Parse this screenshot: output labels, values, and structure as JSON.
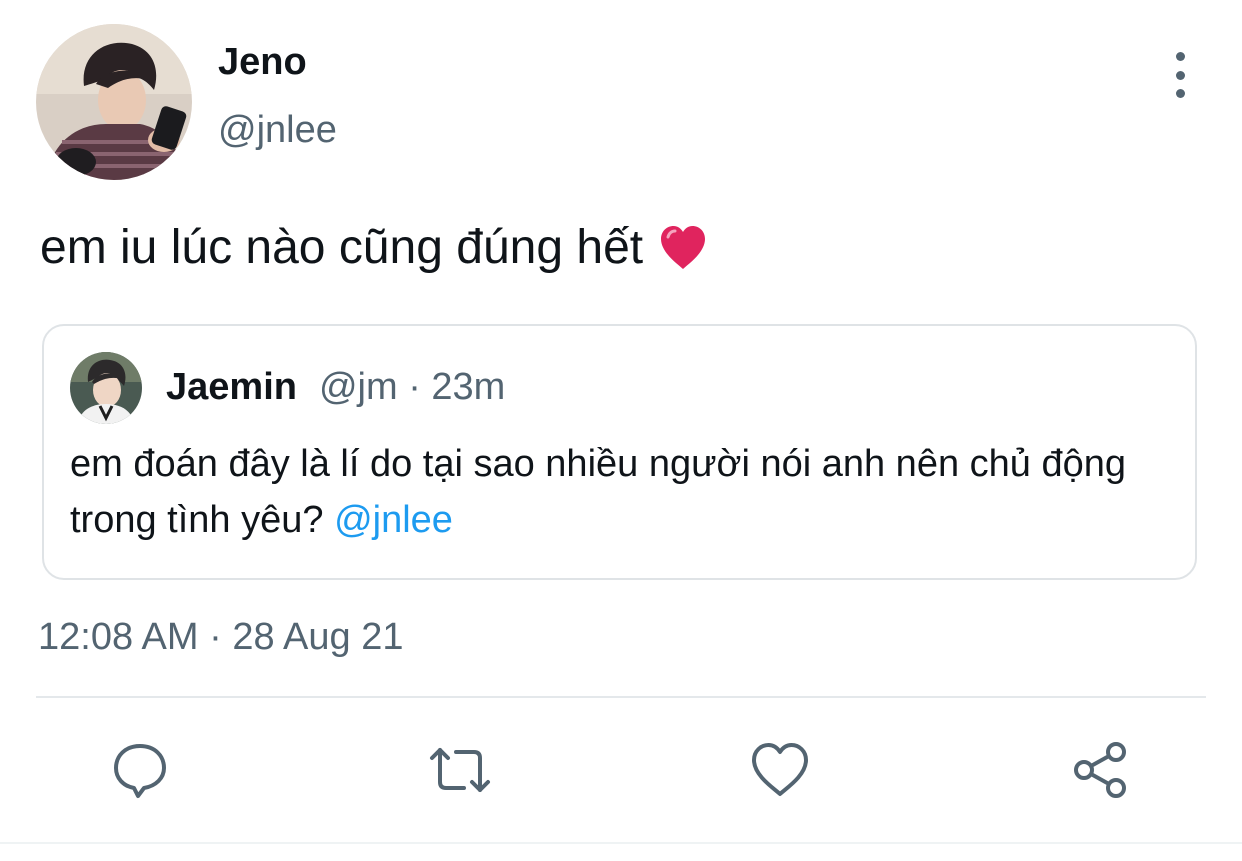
{
  "author": {
    "display_name": "Jeno",
    "handle": "@jnlee"
  },
  "tweet": {
    "text": "em iu lúc nào cũng đúng hết",
    "emoji": "red-heart"
  },
  "quoted_tweet": {
    "display_name": "Jaemin",
    "meta": "@jm · 23m",
    "text": "em đoán đây là lí do tại sao nhiều người nói anh nên chủ động trong tình yêu?",
    "mention": "@jnlee"
  },
  "timestamp": "12:08 AM · 28 Aug 21",
  "actions": [
    "reply-icon",
    "retweet-icon",
    "like-icon",
    "share-icon"
  ],
  "colors": {
    "text": "#0f1419",
    "secondary": "#536471",
    "link": "#1d9bf0",
    "border": "#dfe3e6",
    "heart": "#e0245e"
  }
}
